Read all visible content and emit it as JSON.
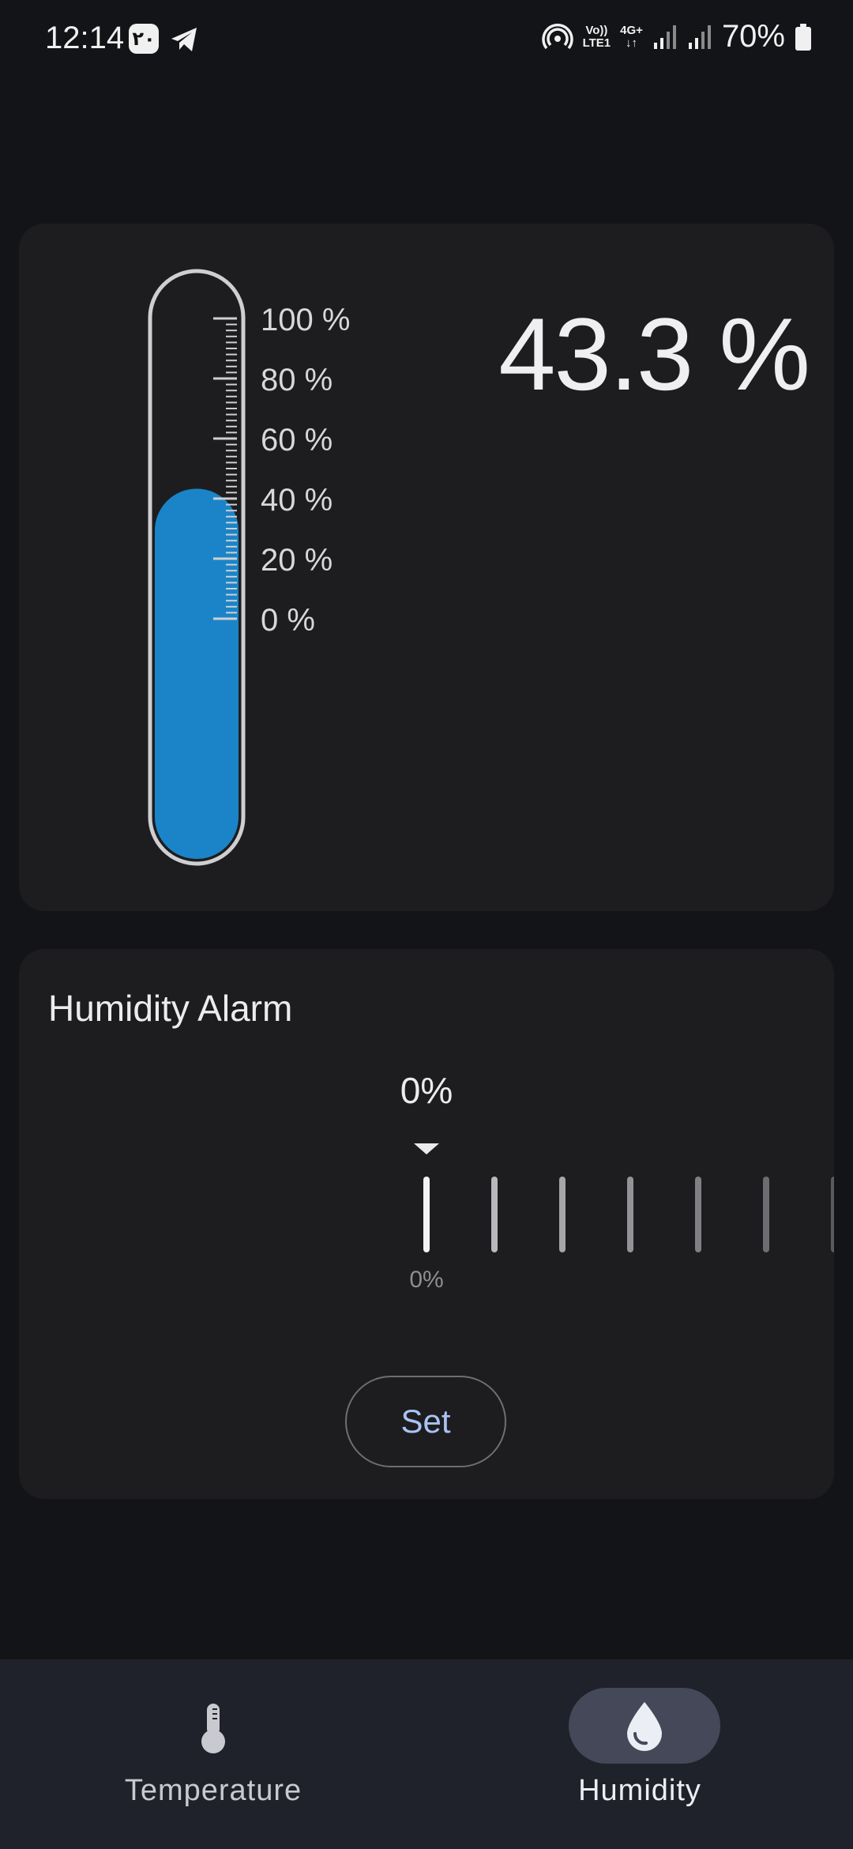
{
  "status_bar": {
    "time": "12:14",
    "badge_text": "۲۰",
    "volte": "Vo))",
    "lte": "LTE1",
    "network": "4G+",
    "battery": "70%",
    "icons": [
      "badge-icon",
      "telegram-plane-icon",
      "hotspot-icon",
      "volte-icon",
      "4g-data-icon",
      "signal-icon",
      "signal-icon",
      "battery-icon"
    ]
  },
  "gauge": {
    "reading": "43.3 %",
    "level_percent": 43.3,
    "scale_labels": [
      "100 %",
      "80 %",
      "60 %",
      "40 %",
      "20 %",
      "0 %"
    ],
    "fill_color": "#1b84c8"
  },
  "alarm": {
    "title": "Humidity Alarm",
    "current_value": "0%",
    "dial_label": "0%",
    "set_label": "Set"
  },
  "nav": {
    "temperature_label": "Temperature",
    "humidity_label": "Humidity",
    "selected": "humidity"
  },
  "colors": {
    "background": "#131417",
    "card": "#1d1d20",
    "accent_text": "#a9c3f2",
    "nav_pill": "#444858"
  }
}
